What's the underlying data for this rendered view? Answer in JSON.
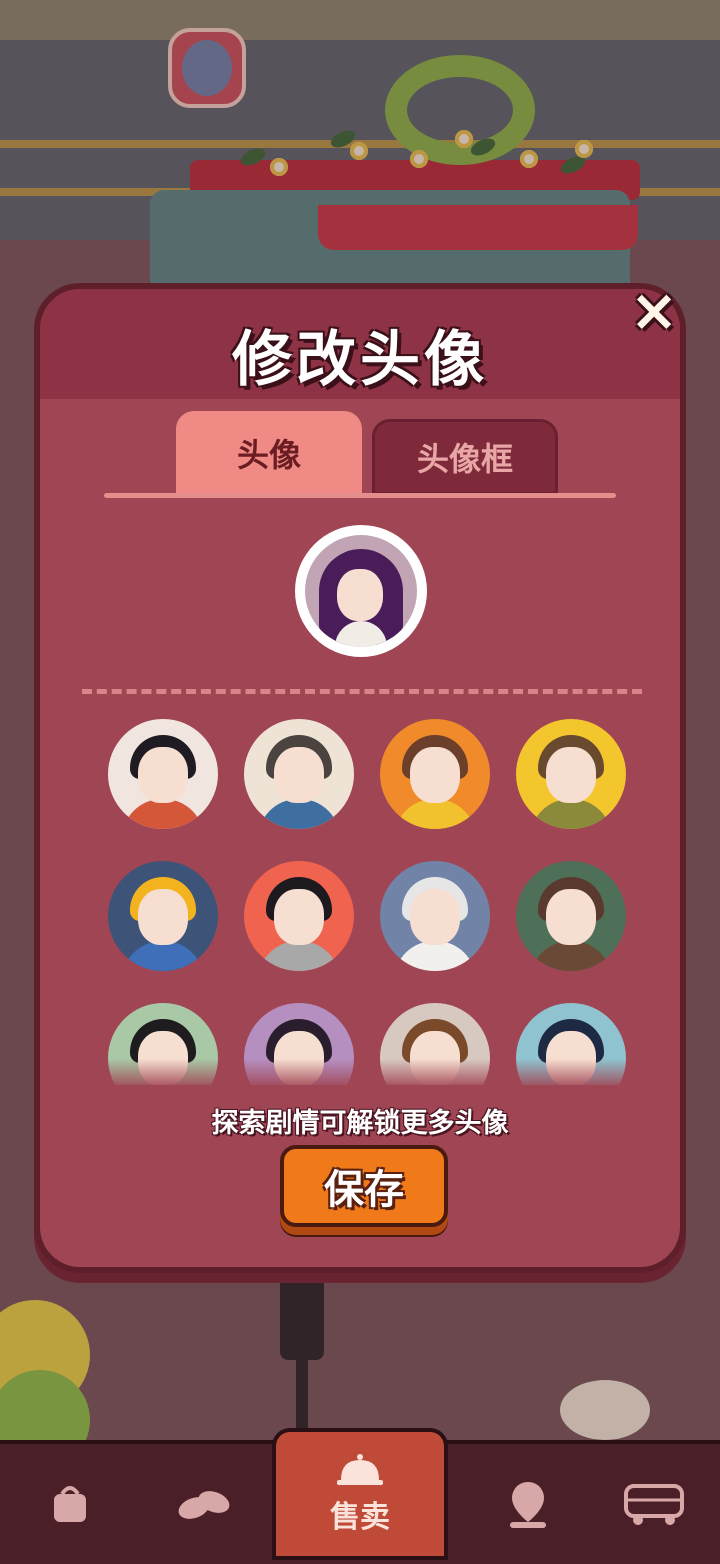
{
  "modal": {
    "title": "修改头像",
    "close_icon": "×",
    "tabs": [
      {
        "label": "头像",
        "active": true
      },
      {
        "label": "头像框",
        "active": false
      }
    ],
    "hint": "探索剧情可解锁更多头像",
    "save_label": "保存"
  },
  "selected_avatar": {
    "name": "purple-hair-girl-avatar"
  },
  "avatar_grid": [
    {
      "name": "braided-girl-avatar",
      "bg": "#f1e6df",
      "hair": "#1e1c22",
      "body": "#d5573a"
    },
    {
      "name": "glasses-man-avatar",
      "bg": "#efe3d6",
      "hair": "#4a4340",
      "body": "#3f6fa0"
    },
    {
      "name": "brown-hair-girl-orange-avatar",
      "bg": "#f08a2a",
      "hair": "#6b3f2a",
      "body": "#f2c12e"
    },
    {
      "name": "short-hair-girl-yellow-avatar",
      "bg": "#f3c62e",
      "hair": "#6a4a2e",
      "body": "#8a8a3a"
    },
    {
      "name": "yellow-helmet-boy-avatar",
      "bg": "#3d5478",
      "hair": "#f2b31f",
      "body": "#3f6fb8"
    },
    {
      "name": "bob-hair-woman-avatar",
      "bg": "#f0634e",
      "hair": "#1c1a1e",
      "body": "#a8a8a8"
    },
    {
      "name": "old-man-avatar",
      "bg": "#7184a8",
      "hair": "#e6e6e6",
      "body": "#f2f0ec"
    },
    {
      "name": "cap-glasses-man-avatar",
      "bg": "#4f7058",
      "hair": "#5a3a2e",
      "body": "#6a4a36"
    },
    {
      "name": "sunglasses-man-avatar",
      "bg": "#a8c8a6",
      "hair": "#1e1c1e",
      "body": "#3a2c28"
    },
    {
      "name": "dark-hair-girl-purple-avatar",
      "bg": "#b58fc0",
      "hair": "#2a1e2e",
      "body": "#4f7a5a"
    },
    {
      "name": "brown-hair-boy-avatar",
      "bg": "#d8c9c0",
      "hair": "#7a4a2a",
      "body": "#e88a3a"
    },
    {
      "name": "wavy-hair-girl-avatar",
      "bg": "#8fc3cf",
      "hair": "#1e2a44",
      "body": "#e8d8d0"
    }
  ],
  "bottom_nav": {
    "items": [
      {
        "name": "shop-bag-icon"
      },
      {
        "name": "ingredients-icon"
      },
      {
        "name": "sell-tab",
        "label": "售卖",
        "icon": "service-bell-icon"
      },
      {
        "name": "map-icon"
      },
      {
        "name": "bus-icon"
      }
    ]
  },
  "colors": {
    "modal_bg": "#a04554",
    "header_bg": "#8d3345",
    "tab_active": "#f08a84",
    "tab_inactive": "#7f2a3a",
    "save_button": "#f07a1a",
    "nav_bg": "#4a1f27",
    "nav_active": "#c04a38"
  }
}
